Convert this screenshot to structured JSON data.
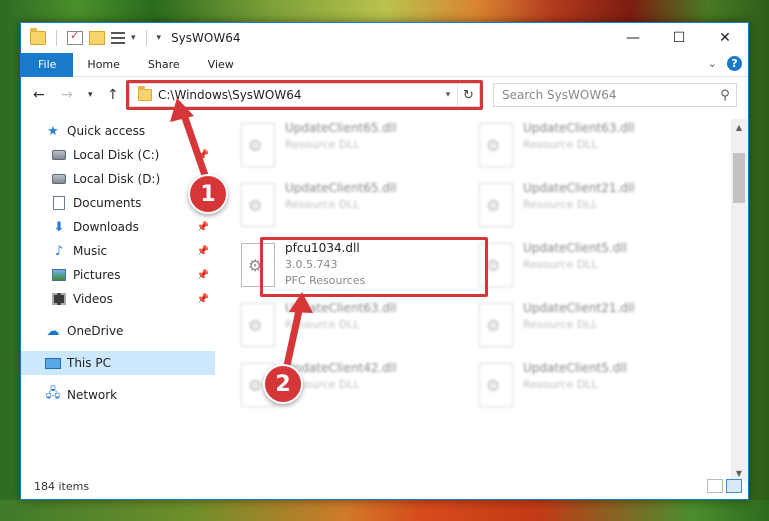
{
  "window": {
    "title": "SysWOW64",
    "controls": {
      "minimize": "—",
      "maximize": "☐",
      "close": "✕"
    }
  },
  "ribbon": {
    "tabs": [
      "File",
      "Home",
      "Share",
      "View"
    ]
  },
  "address": {
    "path": "C:\\Windows\\SysWOW64",
    "search_placeholder": "Search SysWOW64"
  },
  "sidebar": {
    "items": [
      {
        "label": "Quick access",
        "icon": "star-icon"
      },
      {
        "label": "Local Disk (C:)",
        "icon": "disk-icon",
        "pinned": true
      },
      {
        "label": "Local Disk (D:)",
        "icon": "disk-icon"
      },
      {
        "label": "Documents",
        "icon": "documents-icon",
        "pinned": true
      },
      {
        "label": "Downloads",
        "icon": "download-icon",
        "pinned": true
      },
      {
        "label": "Music",
        "icon": "music-icon",
        "pinned": true
      },
      {
        "label": "Pictures",
        "icon": "pictures-icon",
        "pinned": true
      },
      {
        "label": "Videos",
        "icon": "videos-icon",
        "pinned": true
      },
      {
        "label": "OneDrive",
        "icon": "cloud-icon"
      },
      {
        "label": "This PC",
        "icon": "computer-icon",
        "selected": true
      },
      {
        "label": "Network",
        "icon": "network-icon"
      }
    ]
  },
  "files": [
    {
      "name": "UpdateClient65.dll",
      "line1": "Resource DLL",
      "line2": "",
      "blurred": true
    },
    {
      "name": "UpdateClient63.dll",
      "line1": "Resource DLL",
      "line2": "",
      "blurred": true
    },
    {
      "name": "UpdateClient65.dll",
      "line1": "Resource DLL",
      "line2": "",
      "blurred": true
    },
    {
      "name": "UpdateClient21.dll",
      "line1": "Resource DLL",
      "line2": "",
      "blurred": true
    },
    {
      "name": "pfcu1034.dll",
      "line1": "3.0.5.743",
      "line2": "PFC Resources",
      "blurred": false
    },
    {
      "name": "UpdateClient5.dll",
      "line1": "Resource DLL",
      "line2": "",
      "blurred": true
    },
    {
      "name": "UpdateClient63.dll",
      "line1": "Resource DLL",
      "line2": "",
      "blurred": true
    },
    {
      "name": "UpdateClient21.dll",
      "line1": "Resource DLL",
      "line2": "",
      "blurred": true
    },
    {
      "name": "UpdateClient42.dll",
      "line1": "Resource DLL",
      "line2": "",
      "blurred": true
    },
    {
      "name": "UpdateClient5.dll",
      "line1": "Resource DLL",
      "line2": "",
      "blurred": true
    }
  ],
  "status": {
    "item_count": "184 items"
  },
  "annotations": {
    "step1": "1",
    "step2": "2",
    "highlight_color": "#d63638"
  }
}
